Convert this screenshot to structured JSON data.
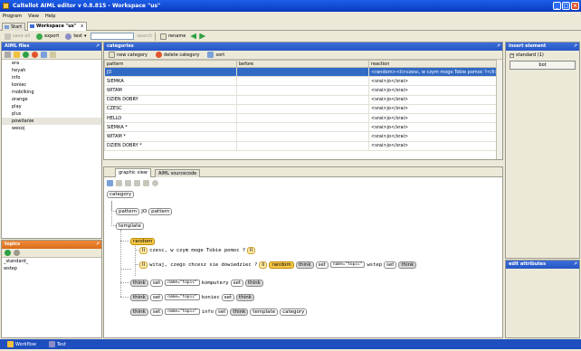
{
  "window": {
    "title": "Caltellot AIML editor v 0.8.815 - Workspace \"us\""
  },
  "menu": [
    "Program",
    "View",
    "Help"
  ],
  "doc_tabs": [
    {
      "label": "Start"
    },
    {
      "label": "Workspace \"us\"",
      "close": "x"
    }
  ],
  "toolbar": {
    "save_all": "save all",
    "export": "export",
    "test": "test",
    "search_label": "search",
    "search_value": "",
    "rename": "rename"
  },
  "aiml_files": {
    "title": "AIML files",
    "pin": "↗",
    "items": [
      "era",
      "heyah",
      "info",
      "koniec",
      "mobilking",
      "orange",
      "play",
      "plus",
      "powitanie",
      "wesoj"
    ],
    "selected": "powitanie"
  },
  "topics": {
    "title": "topics",
    "pin": "↗",
    "items": [
      "_standard_",
      "wstep"
    ]
  },
  "categories": {
    "title": "categories",
    "pin": "↗",
    "buttons": {
      "new": "new category",
      "delete": "delete category",
      "sort": "sort"
    },
    "columns": [
      "pattern",
      "before",
      "reaction"
    ],
    "rows": [
      {
        "pattern": "JO",
        "before": "",
        "reaction": "<random><li>czesc, w czym moge Tobie pomoc ?</li><li>"
      },
      {
        "pattern": "SIEMKA",
        "before": "",
        "reaction": "<srai>jo</srai>"
      },
      {
        "pattern": "WITAM",
        "before": "",
        "reaction": "<srai>jo</srai>"
      },
      {
        "pattern": "DZIEN DOBRY",
        "before": "",
        "reaction": "<srai>jo</srai>"
      },
      {
        "pattern": "CZESC",
        "before": "",
        "reaction": "<srai>jo</srai>"
      },
      {
        "pattern": "HELLO",
        "before": "",
        "reaction": "<srai>jo</srai>"
      },
      {
        "pattern": "SIEMKA *",
        "before": "",
        "reaction": "<srai>jo</srai>"
      },
      {
        "pattern": "WITAM *",
        "before": "",
        "reaction": "<srai>jo</srai>"
      },
      {
        "pattern": "DZIEN DOBRY *",
        "before": "",
        "reaction": "<srai>jo</srai>"
      }
    ]
  },
  "editor": {
    "tabs": [
      "graphic view",
      "AIML sourcecode"
    ],
    "tree": {
      "category": "category",
      "pattern": "pattern",
      "pattern_text": "JO",
      "template": "template",
      "random": "random",
      "li": "li",
      "li1_text": "czesc, w czym moge Tobie pomoc ?",
      "li2_text": "witaj, czego chcesz sie dowiedziec ?",
      "think": "think",
      "set": "set",
      "set_attr": "name=\"topic\"",
      "wstep": "wstep",
      "komputery": "komputery",
      "koniec": "koniec",
      "info": "info"
    }
  },
  "insert_element": {
    "title": "insert element",
    "pin": "↗",
    "group": "standard (1)",
    "button": "bot"
  },
  "edit_attributes": {
    "title": "edit attributes",
    "pin": "↗"
  },
  "statusbar": {
    "workflow": "Workflow",
    "test": "Test"
  }
}
